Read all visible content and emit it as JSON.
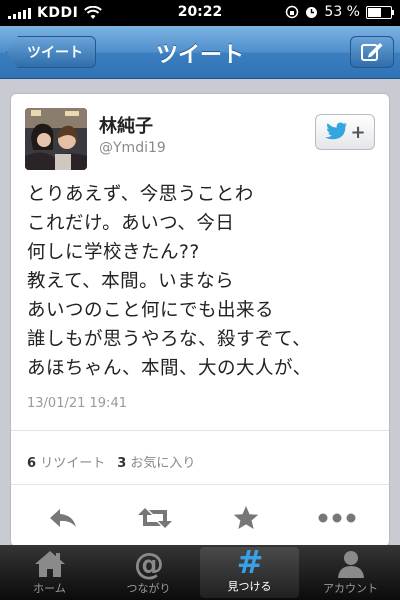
{
  "status_bar": {
    "carrier": "KDDI",
    "time": "20:22",
    "battery": "53 %",
    "battery_level": 0.53
  },
  "navbar": {
    "back_label": "ツイート",
    "title": "ツイート",
    "compose_icon": "compose-icon"
  },
  "tweet": {
    "author_name": "林純子",
    "author_handle": "@Ymdi19",
    "follow_icon": "twitter-bird-icon",
    "follow_plus": "+",
    "lines": [
      "とりあえず、今思うことわ",
      "これだけ。あいつ、今日",
      "何しに学校きたん??",
      "教えて、本間。いまなら",
      "あいつのこと何にでも出来る",
      "誰しもが思うやろな、殺すぞて、",
      "あほちゃん、本間、大の大人が、"
    ],
    "timestamp": "13/01/21 19:41",
    "retweet_count": "6",
    "retweet_label": "リツイート",
    "favorite_count": "3",
    "favorite_label": "お気に入り"
  },
  "actions": [
    "reply-icon",
    "retweet-icon",
    "star-icon",
    "more-icon"
  ],
  "tab_bar": {
    "items": [
      {
        "label": "ホーム",
        "icon": "home-icon",
        "active": false
      },
      {
        "label": "つながり",
        "icon": "at-icon",
        "active": false
      },
      {
        "label": "見つける",
        "icon": "hash-icon",
        "active": true
      },
      {
        "label": "アカウント",
        "icon": "person-icon",
        "active": false
      }
    ]
  },
  "colors": {
    "nav_blue": "#3b7fc1",
    "twitter_blue": "#33a6e0",
    "icon_gray": "#777777"
  }
}
